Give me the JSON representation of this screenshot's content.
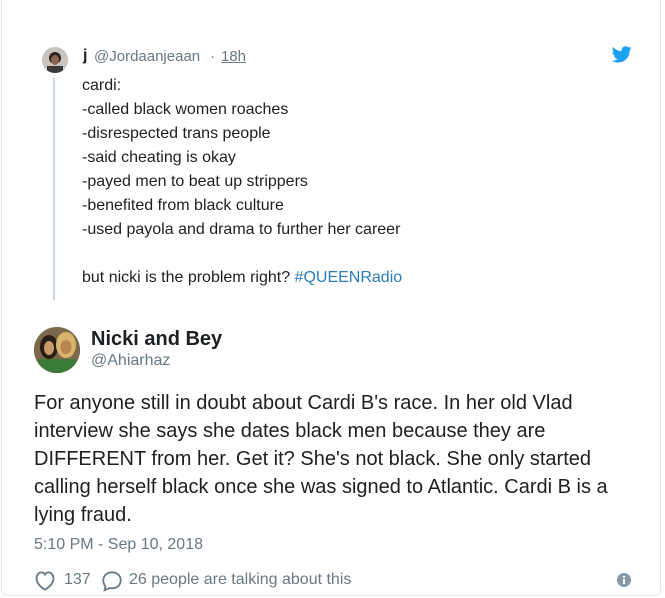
{
  "quoted_tweet": {
    "author_name": "j",
    "handle": "@Jordaanjeaan",
    "separator": "·",
    "time": "18h",
    "lines": [
      "cardi:",
      "-called black women roaches",
      "-disrespected trans people",
      "-said cheating is okay",
      "-payed men to beat up strippers",
      "-benefited from black culture",
      "-used payola and drama to further her career"
    ],
    "last_line_text": "but nicki is the problem right? ",
    "hashtag": "#QUEENRadio"
  },
  "tweet": {
    "author_name": "Nicki and Bey",
    "handle": "@Ahiarhaz",
    "body_lines": [
      "For anyone still in doubt about Cardi B's race. In her old Vlad",
      "interview she says she dates black men because they are",
      "DIFFERENT from her. Get it? She's not black. She only started",
      "calling herself black once she was signed to Atlantic. Cardi B is a",
      "lying fraud."
    ],
    "timestamp": "5:10 PM - Sep 10, 2018",
    "likes": "137",
    "talking": "26 people are talking about this"
  },
  "colors": {
    "twitter_blue": "#1da1f2",
    "hashtag": "#2b7bb9",
    "muted": "#697882"
  },
  "icons": [
    "twitter-bird-icon",
    "heart-icon",
    "reply-icon",
    "info-icon"
  ]
}
